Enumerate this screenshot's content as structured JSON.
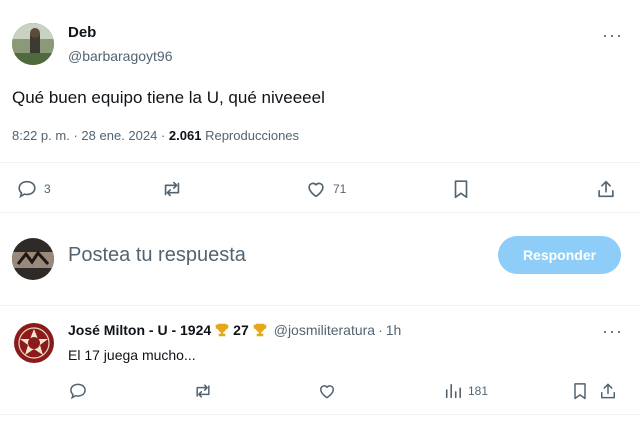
{
  "main_tweet": {
    "author_name": "Deb",
    "handle": "@barbaragoyt96",
    "text": "Qué buen equipo tiene la U, qué niveeeel",
    "time": "8:22 p. m.",
    "sep": "·",
    "date": "28 ene. 2024",
    "views_count": "2.061",
    "views_label": "Reproducciones",
    "more_label": "···",
    "actions": {
      "replies": "3",
      "retweets": "",
      "likes": "71"
    }
  },
  "compose": {
    "placeholder": "Postea tu respuesta",
    "reply_button": "Responder"
  },
  "reply_tweet": {
    "author_name": "José Milton - U - 1924",
    "trophy_number": "27",
    "handle": "@josmiliteratura",
    "sep": "·",
    "age": "1h",
    "text": "El 17 juega mucho...",
    "more_label": "···",
    "actions": {
      "views": "181"
    }
  },
  "colors": {
    "accent_disabled": "#8ecdf8",
    "text_muted": "#536471",
    "trophy": "#e6a817",
    "reply_avatar_bg": "#8b1a1a"
  }
}
